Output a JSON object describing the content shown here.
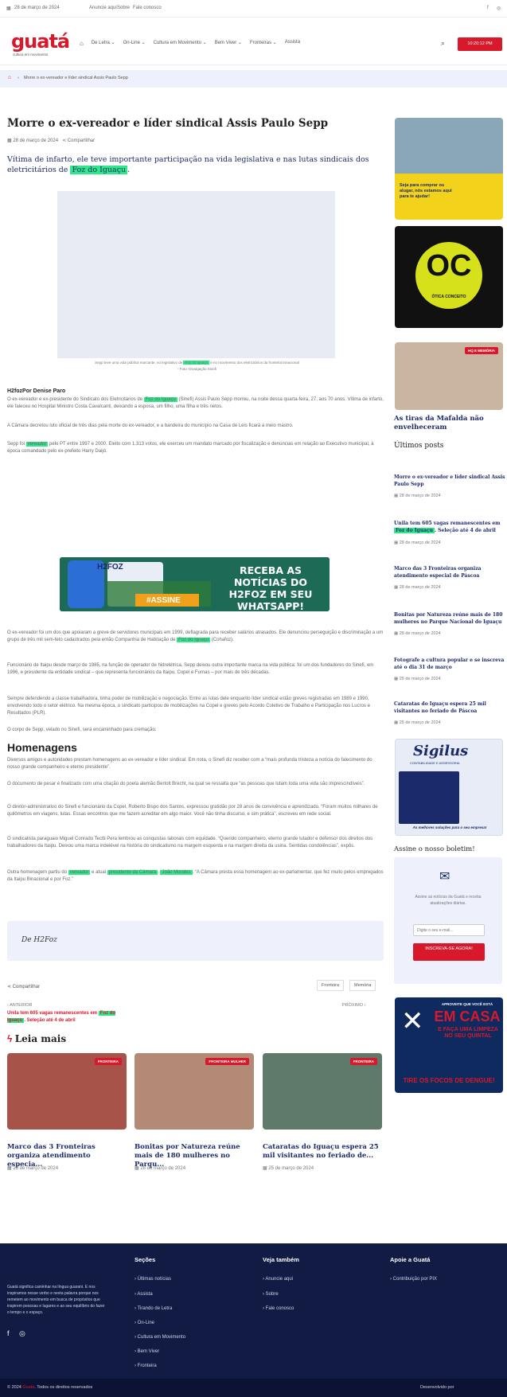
{
  "topbar": {
    "date": "28 de março de 2024",
    "links": [
      "Anuncie aqui",
      "Sobre",
      "Fale conosco"
    ]
  },
  "header": {
    "logo": "guatá",
    "logo_sub": "cultura em movimento",
    "nav": [
      "Início",
      "De Letra",
      "On-Line",
      "Cultura em Movimento",
      "Bem Viver",
      "Fronteiras",
      "Assista"
    ],
    "time": "10:20:12 PM"
  },
  "breadcrumb": {
    "current": "Morre o ex-vereador e líder sindical Assis Paulo Sepp"
  },
  "article": {
    "title": "Morre o ex-vereador e líder sindical Assis Paulo Sepp",
    "date": "28 de março de 2024",
    "share": "Compartilhar",
    "lead_a": "Vítima de infarto, ele teve importante participação na vida legislativa e nas lutas sindicais dos eletricitários de ",
    "lead_hl": "Foz do Iguaçu",
    "lead_b": ".",
    "caption_a": "Sepp teve uma vida pública marcante, no legislativo de ",
    "caption_hl": "Foz do Iguaçu",
    "caption_b": " e no movimento dos eletricitários da fronteira trinacional",
    "caption_credit": "- Foto: Divulgação Sinefi",
    "byline": "H2fozPor Denise Paro",
    "p1_a": "O ex-vereador e ex-presidente do Sindicato dos Eletricitários de ",
    "p1_hl": "Foz do Iguaçu",
    "p1_b": " (Sinefi) Assis Paulo Sepp morreu, na noite dessa quarta-feira, 27, aos 70 anos. Vítima de infarto, ele faleceu no Hospital Ministro Costa Cavalcanti, deixando a esposa, um filho, uma filha e três netos.",
    "p2": "A Câmara decretou luto oficial de três dias pela morte do ex-vereador, e a bandeira do município na Casa de Leis ficará a meio mastro.",
    "p3_a": "Sepp foi ",
    "p3_hl": "vereador",
    "p3_b": " pelo PT entre 1997 e 2000. Eleito com 1.313 votos, ele exerceu um mandato marcado por fiscalização e denúncias em relação ao Executivo municipal, à época comandado pelo ex-prefeito Harry Daijó.",
    "banner_brand": "H2FOZ",
    "banner_text": "RECEBA AS NOTÍCIAS DO H2FOZ EM SEU WHATSAPP!",
    "banner_cta": "#ASSINE",
    "p4_a": "O ex-vereador foi um dos que apoiaram a greve de servidores municipais em 1999, deflagrada para receber salários atrasados. Ele denunciou perseguição e discriminação a um grupo de três mil sem-teto cadastrados pela então Companhia de Habitação de ",
    "p4_hl": "Foz do Iguaçu",
    "p4_b": " (Cohafoz).",
    "p5": "Funcionário de Itaipu desde março de 1985, na função de operador de hidrelétrica, Sepp deixou outra importante marca na vida pública: foi um dos fundadores do Sinefi, em 1996, e presidente da entidade sindical – que representa funcionários da Itaipu, Copel e Furnas – por mais de três décadas.",
    "p6": "Sempre defendendo a classe trabalhadora, tinha poder de mobilização e negociação. Entre as lutas dele enquanto líder sindical estão greves registradas em 1989 e 1990, envolvendo todo o setor elétrico. Na mesma época, o sindicato participou de mobilizações na Copel e greves pelo Acordo Coletivo de Trabalho e Participação nos Lucros e Resultados (PLR).",
    "p7": "O corpo de Sepp, velado no Sinefi, será encaminhado para cremação.",
    "h_homenagens": "Homenagens",
    "p8": "Diversos amigos e autoridades prestam homenagens ao ex-vereador e líder sindical. Em nota, o Sinefi diz receber com a “mais profunda tristeza a notícia do falecimento do nosso grande companheiro e eterno presidente”.",
    "p9": "O documento de pesar é finalizado com uma citação do poeta alemão Bertolt Brecht, na qual se ressalta que “as pessoas que lutam toda uma vida são imprescindíveis”.",
    "p10": "O diretor-administrativo do Sinefi e funcionário da Copel, Roberto Bispo dos Santos, expressou gratidão por 28 anos de convivência e aprendizado. “Foram muitos milhares de quilômetros em viagens, lutas. Essas encontros que me fazem acreditar em algo maior. Você não tinha discurso, e sim prática”, escreveu em rede social.",
    "p11": "O sindicalista paraguaio Miguel Conrado Tectti Pera lembrou as conquistas laborais com equidade. “Querido companheiro, eterno grande lutador e defensor dos direitos dos trabalhadores da Itaipu. Deixou uma marca indelével na história do sindicalismo na margem esquerda e na margem direita da usina. Sentidas condolências”, expôs.",
    "p12_a": "Outra homenagem partiu do ",
    "p12_hl1": "vereador",
    "p12_m1": " e atual ",
    "p12_hl2": "presidente da Câmara",
    "p12_m2": ", ",
    "p12_hl3": "João Morales",
    "p12_b": ". “A Câmara presta essa homenagem ao ex-parlamentar, que fez muito pelos empregados da Itaipu Binacional e por Foz.”",
    "quote_source": "De H2Foz",
    "tags": [
      "Fronteira",
      "Memória"
    ],
    "prev_label": "ANTERIOR",
    "prev_a": "Unila tem 605 vagas remanescentes em ",
    "prev_hl": "Foz do Iguaçu",
    "prev_b": ". Seleção até 4 de abril",
    "next_label": "PRÓXIMO"
  },
  "leia_mais": {
    "heading": "Leia mais",
    "cards": [
      {
        "tag": "FRONTEIRA",
        "title": "Marco das 3 Fronteiras organiza atendimento especia...",
        "date": "28 de março de 2024"
      },
      {
        "tag": "FRONTEIRA MULHER",
        "title": "Bonitas por Natureza reúne mais de 180 mulheres no Parqu...",
        "date": "28 de março de 2024"
      },
      {
        "tag": "FRONTEIRA",
        "title": "Cataratas do Iguaçu espera 25 mil visitantes no feriado de...",
        "date": "25 de março de 2024"
      }
    ]
  },
  "sidebar": {
    "ad1_text": "Seja para comprar ou alugar, nós estamos aqui para te ajudar!",
    "ad2_text": "OC",
    "ad2_sub": "ÓTICA CONCEITO",
    "feature_tag": "HQ E MEMÓRIA",
    "feature_title": "As tiras da Mafalda não envelheceram",
    "recent_heading": "Últimos posts",
    "posts": [
      {
        "title": "Morre o ex-vereador e líder sindical Assis Paulo Sepp",
        "date": "28 de março de 2024"
      },
      {
        "title_a": "Unila tem 605 vagas remanescentes em ",
        "title_hl": "Foz do Iguaçu",
        "title_b": ". Seleção até 4 de abril",
        "date": "28 de março de 2024"
      },
      {
        "title": "Marco das 3 Fronteiras organiza atendimento especial de Páscoa",
        "date": "28 de março de 2024"
      },
      {
        "title": "Bonitas por Natureza reúne mais de 180 mulheres no Parque Nacional do Iguaçu",
        "date": "28 de março de 2024"
      },
      {
        "title": "Fotografe a cultura popular e se inscreva até o dia 31 de março",
        "date": "25 de março de 2024"
      },
      {
        "title": "Cataratas do Iguaçu espera 25 mil visitantes no feriado de Páscoa",
        "date": "25 de março de 2024"
      }
    ],
    "sigilus_brand": "Sigilus",
    "sigilus_sub": "CONTABILIDADE E ASSESSORIA",
    "sigilus_tagline": "As melhores soluções para o seu empresa!",
    "newsletter_heading": "Assine o nosso boletim!",
    "newsletter_text": "Assine as notícias da Guatá e receba atualizações diárias.",
    "newsletter_placeholder": "Digite o seu e-mail...",
    "newsletter_button": "INSCREVA-SE AGORA!",
    "dengue_top": "APROVEITE QUE VOCÊ ESTÁ",
    "dengue_big": "EM CASA",
    "dengue_mid": "E FAÇA UMA LIMPEZA NO SEU QUINTAL",
    "dengue_bottom": "TIRE OS FOCOS DE DENGUE!"
  },
  "footer": {
    "about": "Guatá significa caminhar na língua guarani. E nos inspiramos nesse verbo e nesta palavra porque nos remetem ao movimento em busca de propósitos que inspirem pessoas e lugares e ao seu equilíbrio do fazer o tempo e o espaço.",
    "col_secoes": {
      "heading": "Seções",
      "links": [
        "Últimas notícias",
        "Assista",
        "Tirando de Letra",
        "On-Line",
        "Cultura em Movimento",
        "Bem Viver",
        "Fronteira"
      ]
    },
    "col_veja": {
      "heading": "Veja também",
      "links": [
        "Anuncie aqui",
        "Sobre",
        "Fale conosco"
      ]
    },
    "col_apoie": {
      "heading": "Apoie a Guatá",
      "links": [
        "Contribuição por PIX"
      ]
    },
    "copyright_a": "© 2024 ",
    "copyright_brand": "Guatá",
    "copyright_b": ". Todos os direitos reservados",
    "developed_by": "Desenvolvido por "
  },
  "colors": {
    "brand_red": "#d8192c",
    "highlight": "#2ee88a",
    "navy": "#111b44",
    "link_blue": "#1b2a6b"
  }
}
